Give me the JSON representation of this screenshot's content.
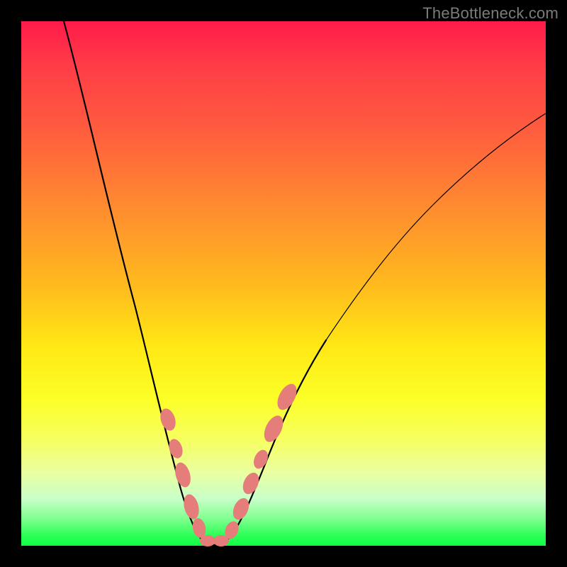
{
  "watermark": "TheBottleneck.com",
  "colors": {
    "frame": "#000000",
    "watermark_text": "#7b7b7b",
    "curve": "#000000",
    "marker": "#e57e7a",
    "gradient_stops": [
      "#ff1a4a",
      "#ff3b47",
      "#ff5a3f",
      "#ff8a30",
      "#ffb91e",
      "#ffe815",
      "#fcff27",
      "#f6ff62",
      "#eaffa0",
      "#c9ffc9",
      "#7dff8d",
      "#2dff58",
      "#0fff45"
    ]
  },
  "chart_data": {
    "type": "line",
    "title": "",
    "xlabel": "",
    "ylabel": "",
    "xlim": [
      0,
      100
    ],
    "ylim": [
      0,
      100
    ],
    "grid": false,
    "series": [
      {
        "name": "bottleneck-curve",
        "x": [
          8,
          12,
          16,
          20,
          24,
          26,
          28,
          30,
          32,
          33,
          34,
          35,
          38,
          42,
          46,
          52,
          58,
          66,
          76,
          88,
          100
        ],
        "values": [
          100,
          85,
          68,
          50,
          32,
          22,
          12,
          5,
          1,
          0,
          0,
          1,
          6,
          16,
          28,
          42,
          54,
          65,
          74,
          81,
          86
        ]
      }
    ],
    "markers": [
      {
        "name": "left-blob-1",
        "x": 26.5,
        "y": 22
      },
      {
        "name": "left-blob-2",
        "x": 28.0,
        "y": 15
      },
      {
        "name": "left-blob-3",
        "x": 29.5,
        "y": 8
      },
      {
        "name": "left-blob-4",
        "x": 31.0,
        "y": 3
      },
      {
        "name": "left-blob-5",
        "x": 32.5,
        "y": 1
      },
      {
        "name": "bottom-blob-1",
        "x": 33.5,
        "y": 0
      },
      {
        "name": "bottom-blob-2",
        "x": 34.5,
        "y": 0
      },
      {
        "name": "right-blob-1",
        "x": 36.0,
        "y": 3
      },
      {
        "name": "right-blob-2",
        "x": 38.0,
        "y": 8
      },
      {
        "name": "right-blob-3",
        "x": 40.0,
        "y": 13
      },
      {
        "name": "right-blob-4",
        "x": 42.0,
        "y": 18
      },
      {
        "name": "right-blob-5",
        "x": 44.5,
        "y": 25
      },
      {
        "name": "right-blob-6",
        "x": 46.5,
        "y": 30
      }
    ]
  }
}
